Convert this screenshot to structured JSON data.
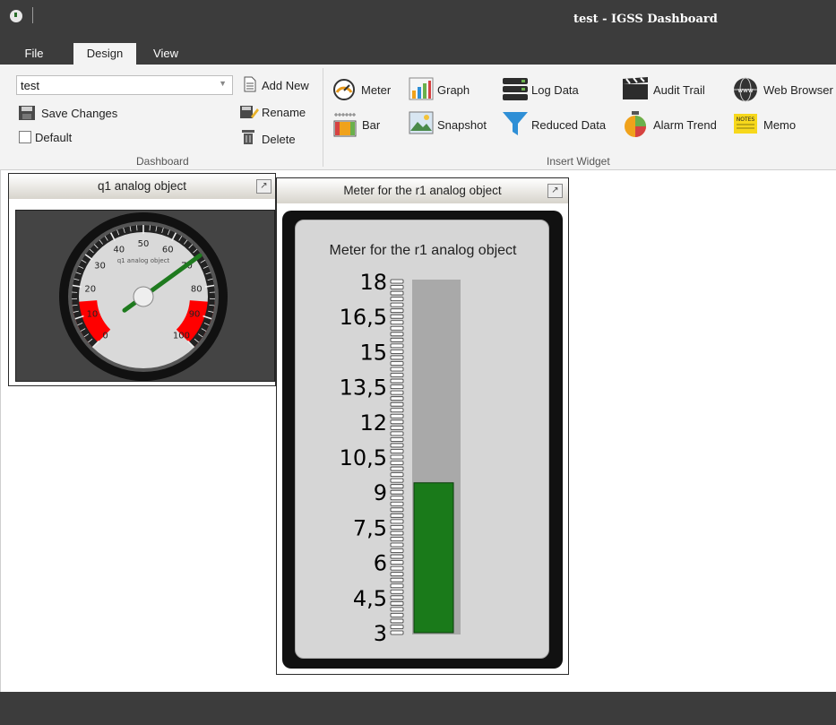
{
  "window": {
    "title": "test - IGSS Dashboard"
  },
  "tabs": [
    {
      "label": "File"
    },
    {
      "label": "Design"
    },
    {
      "label": "View"
    }
  ],
  "ribbon": {
    "dashboard_group": {
      "label": "Dashboard",
      "combo_value": "test",
      "save_changes": "Save Changes",
      "default_label": "Default",
      "add_new": "Add New",
      "rename": "Rename",
      "delete": "Delete"
    },
    "insert_group": {
      "label": "Insert Widget",
      "items": [
        {
          "label": "Meter",
          "icon": "meter-icon"
        },
        {
          "label": "Graph",
          "icon": "graph-icon"
        },
        {
          "label": "Log Data",
          "icon": "log-data-icon"
        },
        {
          "label": "Audit Trail",
          "icon": "audit-trail-icon"
        },
        {
          "label": "Web Browser",
          "icon": "web-browser-icon"
        },
        {
          "label": "Bar",
          "icon": "bar-icon"
        },
        {
          "label": "Snapshot",
          "icon": "snapshot-icon"
        },
        {
          "label": "Reduced Data",
          "icon": "reduced-data-icon"
        },
        {
          "label": "Alarm Trend",
          "icon": "alarm-trend-icon"
        },
        {
          "label": "Memo",
          "icon": "memo-icon"
        }
      ]
    }
  },
  "widgets": {
    "gauge": {
      "title": "q1 analog object",
      "dial_label": "q1 analog object",
      "scale_labels": [
        "0",
        "10",
        "20",
        "30",
        "40",
        "50",
        "60",
        "70",
        "80",
        "90",
        "100"
      ],
      "value": 70,
      "alarm_color": "#ff0000",
      "needle_color": "#1e7a1e"
    },
    "bar_meter": {
      "title": "Meter for the r1 analog object",
      "inner_title": "Meter for the r1 analog object",
      "scale_labels": [
        "18",
        "16,5",
        "15",
        "13,5",
        "12",
        "10,5",
        "9",
        "7,5",
        "6",
        "4,5",
        "3"
      ],
      "min": 3,
      "max": 18,
      "value": 9.4,
      "bar_color": "#1a7a1a",
      "track_color": "#a9a9a9"
    }
  },
  "colors": {
    "chrome": "#3c3c3c",
    "ribbon": "#f3f3f3"
  }
}
